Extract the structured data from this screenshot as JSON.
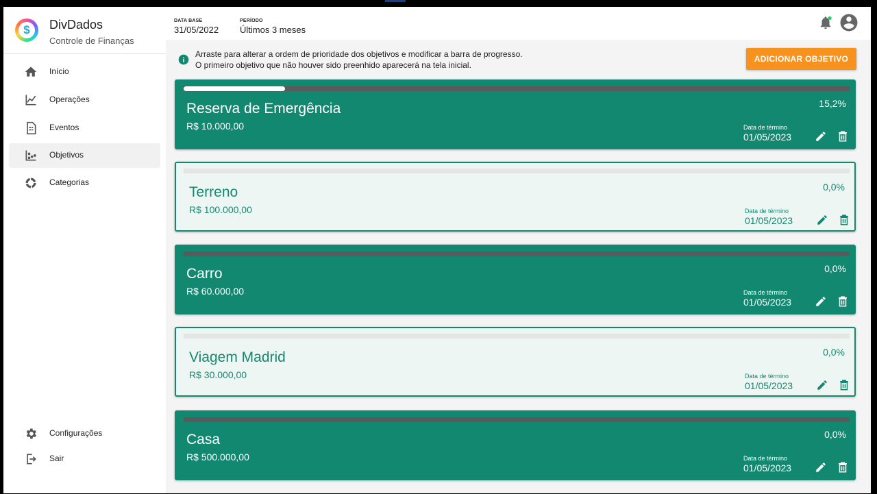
{
  "app": {
    "name": "DivDados",
    "subtitle": "Controle de Finanças"
  },
  "sidebar": {
    "items": [
      {
        "label": "Início",
        "icon": "home-icon"
      },
      {
        "label": "Operações",
        "icon": "chart-line-icon"
      },
      {
        "label": "Eventos",
        "icon": "document-icon"
      },
      {
        "label": "Objetivos",
        "icon": "scatter-icon",
        "active": true
      },
      {
        "label": "Categorias",
        "icon": "donut-icon"
      }
    ],
    "bottom": [
      {
        "label": "Configurações",
        "icon": "gear-icon"
      },
      {
        "label": "Sair",
        "icon": "logout-icon"
      }
    ]
  },
  "header": {
    "data_base_label": "DATA BASE",
    "data_base_value": "31/05/2022",
    "periodo_label": "PERÍODO",
    "periodo_value": "Últimos 3 meses"
  },
  "info": {
    "line1": "Arraste para alterar a ordem de prioridade dos objetivos e modificar a barra de progresso.",
    "line2": "O primeiro objetivo que não houver sido preenhido aparecerá na tela inicial."
  },
  "add_button": "ADICIONAR OBJETIVO",
  "goals": [
    {
      "title": "Reserva de Emergência",
      "amount": "R$ 10.000,00",
      "percent": "15,2%",
      "progress": 0.152,
      "date_label": "Data de término",
      "date": "01/05/2023",
      "style": "filled"
    },
    {
      "title": "Terreno",
      "amount": "R$ 100.000,00",
      "percent": "0,0%",
      "progress": 0,
      "date_label": "Data de término",
      "date": "01/05/2023",
      "style": "outlined"
    },
    {
      "title": "Carro",
      "amount": "R$ 60.000,00",
      "percent": "0,0%",
      "progress": 0,
      "date_label": "Data de término",
      "date": "01/05/2023",
      "style": "filled"
    },
    {
      "title": "Viagem Madrid",
      "amount": "R$ 30.000,00",
      "percent": "0,0%",
      "progress": 0,
      "date_label": "Data de término",
      "date": "01/05/2023",
      "style": "outlined"
    },
    {
      "title": "Casa",
      "amount": "R$ 500.000,00",
      "percent": "0,0%",
      "progress": 0,
      "date_label": "Data de término",
      "date": "01/05/2023",
      "style": "filled"
    }
  ],
  "colors": {
    "primary": "#138871",
    "accent": "#f7921e",
    "notification_dot": "#2ecc71"
  }
}
